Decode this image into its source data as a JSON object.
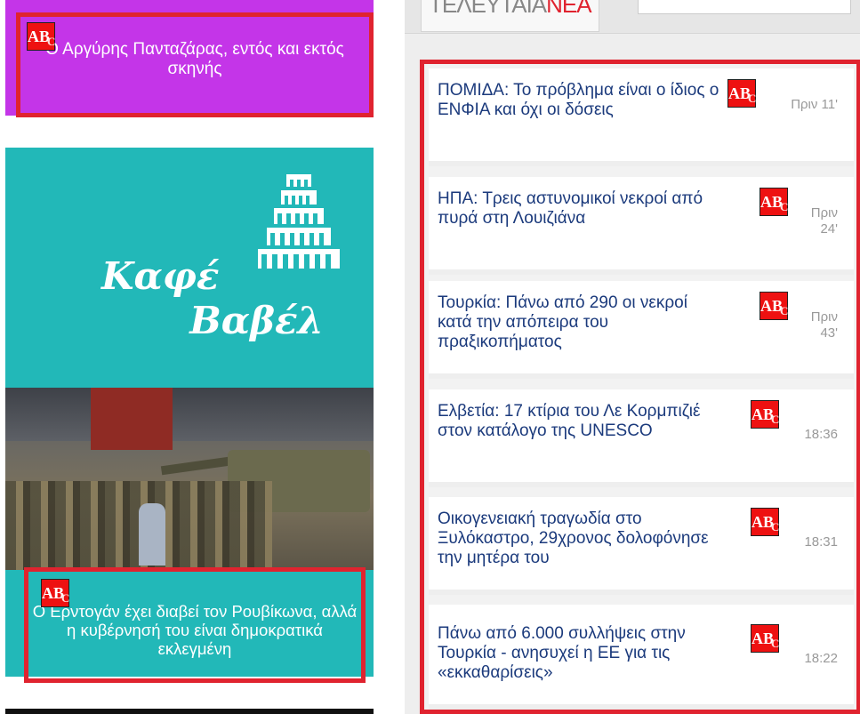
{
  "left": {
    "promo_top": "Ο Αργύρης Πανταζάρας, εντός και εκτός σκηνής",
    "cafe_title_line1": "Καφέ",
    "cafe_title_line2": "Βαβέλ",
    "promo_bottom": "Ο Ερντογάν έχει διαβεί τον Ρουβίκωνα, αλλά η κυβέρνησή του είναι δημοκρατικά εκλεγμένη"
  },
  "right": {
    "tab_label_main": "ΤΕΛΕΥΤΑΙΑ",
    "tab_label_accent": "ΝΕΑ",
    "news": [
      {
        "title": "ΠΟΜΙΔΑ: Το πρόβλημα είναι ο ίδιος ο ΕΝΦΙΑ και όχι οι δόσεις",
        "time": "Πριν 11'"
      },
      {
        "title": "ΗΠΑ: Τρεις αστυνομικοί νεκροί από πυρά στη Λουιζιάνα",
        "time": "Πριν 24'"
      },
      {
        "title": "Τουρκία: Πάνω από 290 οι νεκροί κατά την απόπειρα του πραξικοπήματος",
        "time": "Πριν 43'"
      },
      {
        "title": "Ελβετία: 17 κτίρια του Λε Κορμπιζιέ στον κατάλογο της UNESCO",
        "time": "18:36"
      },
      {
        "title": "Οικογενειακή τραγωδία στο Ξυλόκαστρο, 29χρονος δολοφόνησε την μητέρα του",
        "time": "18:31"
      },
      {
        "title": "Πάνω από 6.000 συλλήψεις στην Τουρκία - ανησυχεί η ΕΕ για τις «εκκαθαρίσεις»",
        "time": "18:22"
      }
    ]
  },
  "icons": {
    "abc": "abc-spellcheck-icon",
    "abc_glyph_a": "A",
    "abc_glyph_b": "B",
    "abc_glyph_c": "C"
  },
  "colors": {
    "accent_red": "#e0232f",
    "purple": "#c435e8",
    "teal": "#22b8b8",
    "headline_blue": "#1b3a7c"
  }
}
